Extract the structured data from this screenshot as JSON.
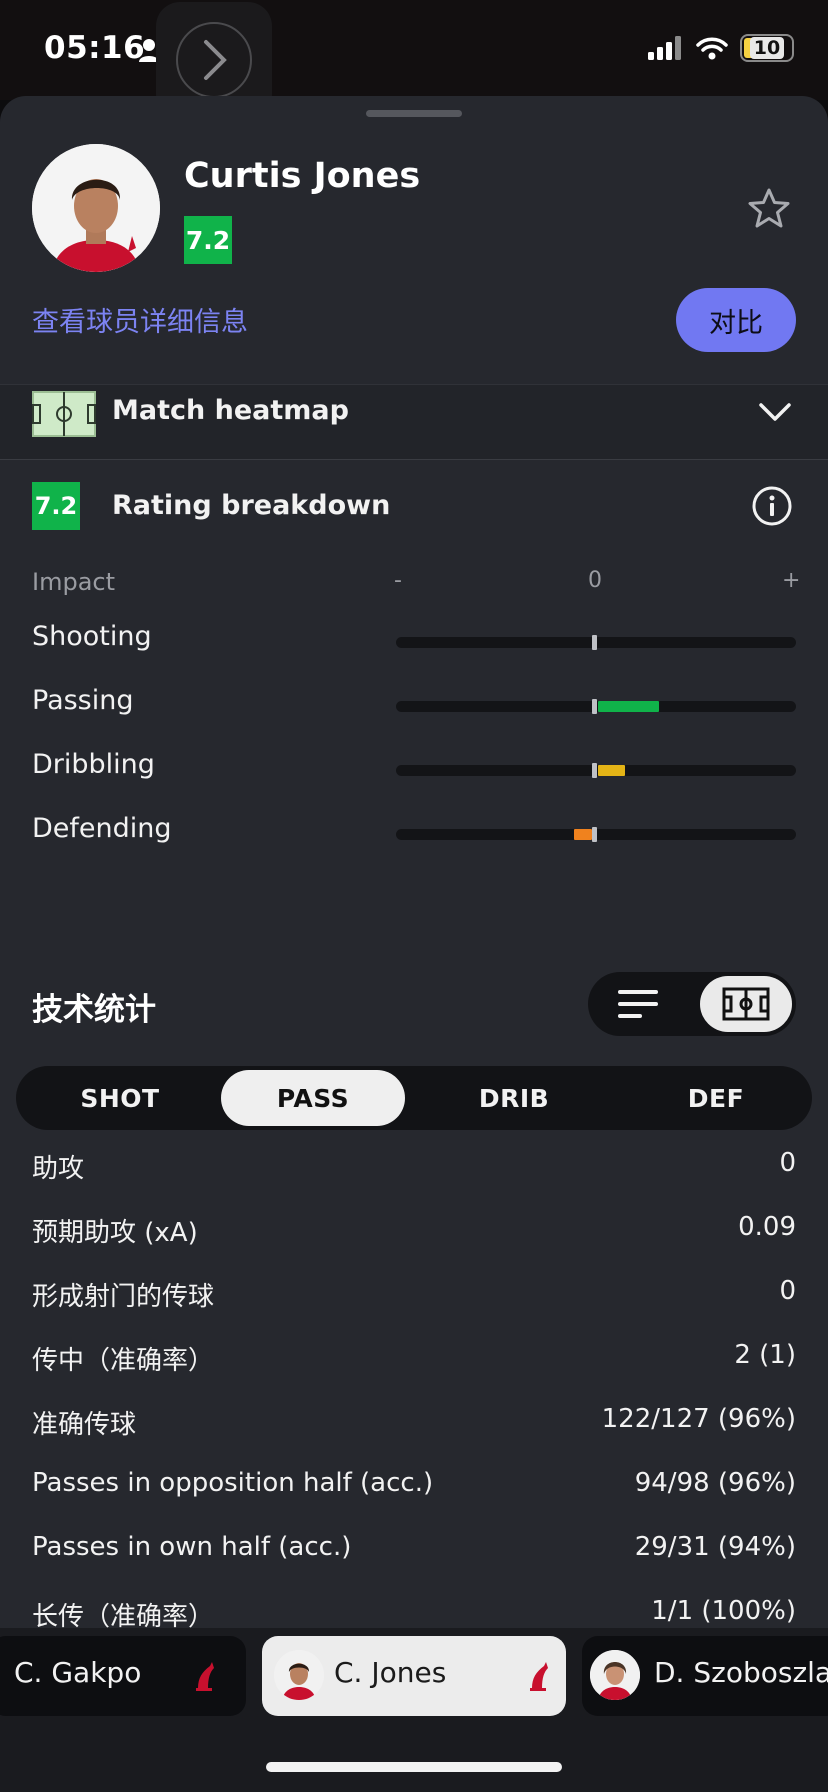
{
  "status_bar": {
    "time": "05:16",
    "battery": "10"
  },
  "player": {
    "name": "Curtis Jones",
    "rating": "7.2",
    "detail_link": "查看球员详细信息",
    "compare_label": "对比"
  },
  "heatmap": {
    "label": "Match heatmap"
  },
  "rating_breakdown": {
    "badge": "7.2",
    "title": "Rating breakdown",
    "impact_label": "Impact",
    "scale_minus": "-",
    "scale_zero": "0",
    "scale_plus": "+",
    "categories": [
      {
        "label": "Shooting",
        "impact": 0.0,
        "color": "#10b34a"
      },
      {
        "label": "Passing",
        "impact": 0.31,
        "color": "#10b34a"
      },
      {
        "label": "Dribbling",
        "impact": 0.14,
        "color": "#e4b416"
      },
      {
        "label": "Defending",
        "impact": -0.09,
        "color": "#f0821e"
      }
    ]
  },
  "tech_stats": {
    "title": "技术统计",
    "tabs": [
      "SHOT",
      "PASS",
      "DRIB",
      "DEF"
    ],
    "active_tab": "PASS",
    "rows": [
      {
        "label": "助攻",
        "value": "0"
      },
      {
        "label": "预期助攻 (xA)",
        "value": "0.09"
      },
      {
        "label": "形成射门的传球",
        "value": "0"
      },
      {
        "label": "传中（准确率）",
        "value": "2 (1)"
      },
      {
        "label": "准确传球",
        "value": "122/127 (96%)"
      },
      {
        "label": "Passes in opposition half (acc.)",
        "value": "94/98 (96%)"
      },
      {
        "label": "Passes in own half (acc.)",
        "value": "29/31 (94%)"
      },
      {
        "label": "长传（准确率）",
        "value": "1/1 (100%)"
      }
    ]
  },
  "player_switcher": [
    {
      "name": "C. Gakpo"
    },
    {
      "name": "C. Jones"
    },
    {
      "name": "D. Szoboszlai"
    }
  ],
  "colors": {
    "accent": "#7178f2",
    "rating_green": "#10b34a",
    "sheet_bg": "#26282e"
  }
}
